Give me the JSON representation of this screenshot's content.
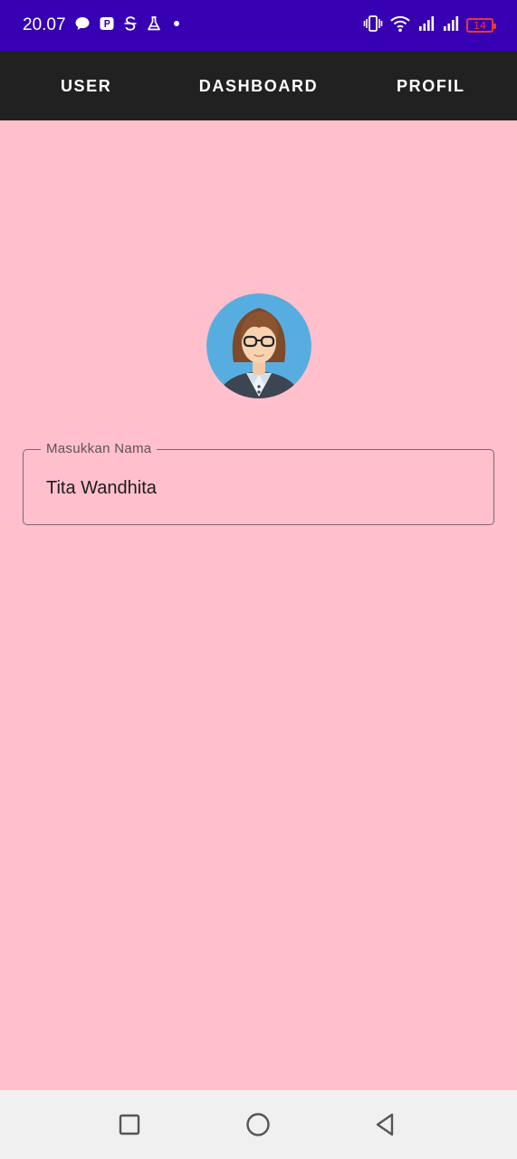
{
  "status_bar": {
    "time": "20.07",
    "battery_level": "14",
    "background_color": "#3700b3",
    "left_icons": [
      "chat-bubble-icon",
      "app-p-icon",
      "app-s-icon",
      "flask-icon",
      "dot-icon"
    ],
    "right_icons": [
      "vibrate-icon",
      "wifi-icon",
      "signal-icon",
      "signal-icon",
      "battery-icon"
    ]
  },
  "tabs": [
    {
      "label": "USER"
    },
    {
      "label": "DASHBOARD"
    },
    {
      "label": "PROFIL"
    }
  ],
  "profile": {
    "avatar_icon": "woman-avatar-icon",
    "name_field": {
      "label": "Masukkan Nama",
      "value": "Tita Wandhita"
    }
  },
  "navigation_bar": {
    "buttons": [
      "recents-square-icon",
      "home-circle-icon",
      "back-triangle-icon"
    ]
  },
  "colors": {
    "tab_bar": "#212121",
    "page_background": "#ffc0cb",
    "battery_warning": "#e53935"
  }
}
